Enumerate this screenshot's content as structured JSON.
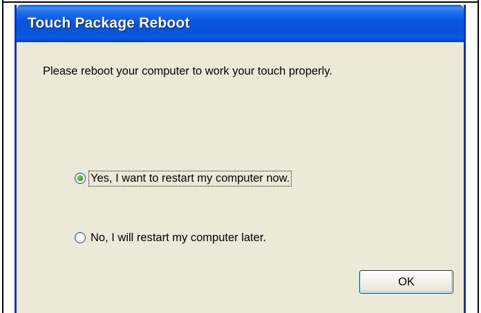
{
  "dialog": {
    "title": "Touch Package Reboot",
    "message": "Please reboot your computer to work your touch properly.",
    "options": [
      {
        "label": "Yes, I want to restart my computer now.",
        "selected": true
      },
      {
        "label": "No, I will restart my computer later.",
        "selected": false
      }
    ],
    "ok_label": "OK"
  },
  "colors": {
    "title_bar": "#0a55dd",
    "dialog_background": "#ece9d8",
    "border": "#0831d9",
    "radio_checked": "#21a121"
  }
}
